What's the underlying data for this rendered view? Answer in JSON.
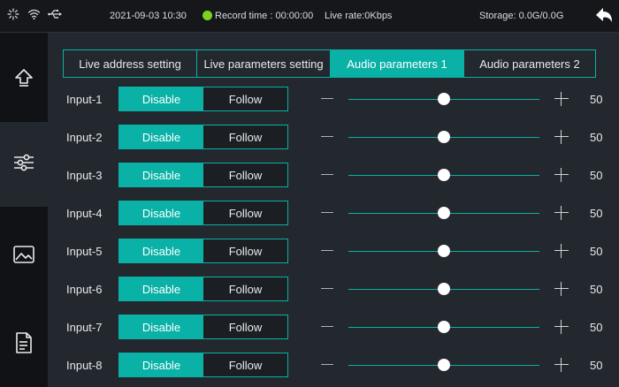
{
  "status_bar": {
    "datetime": "2021-09-03 10:30",
    "record_time": "Record time : 00:00:00",
    "live_rate": "Live rate:0Kbps",
    "storage": "Storage: 0.0G/0.0G",
    "record_indicator_color": "#7ed321"
  },
  "sidebar": {
    "items": [
      {
        "name": "upload",
        "icon": "upload-icon",
        "active": false
      },
      {
        "name": "settings",
        "icon": "sliders-icon",
        "active": true
      },
      {
        "name": "gallery",
        "icon": "image-icon",
        "active": false
      },
      {
        "name": "document",
        "icon": "document-icon",
        "active": false
      }
    ]
  },
  "tabs": [
    {
      "label": "Live address setting",
      "active": false
    },
    {
      "label": "Live parameters setting",
      "active": false
    },
    {
      "label": "Audio parameters 1",
      "active": true
    },
    {
      "label": "Audio parameters 2",
      "active": false
    }
  ],
  "inputs": [
    {
      "label": "Input-1",
      "disable_label": "Disable",
      "follow_label": "Follow",
      "selected": "Disable",
      "volume": 50,
      "level": 0.5
    },
    {
      "label": "Input-2",
      "disable_label": "Disable",
      "follow_label": "Follow",
      "selected": "Disable",
      "volume": 50,
      "level": 0.5
    },
    {
      "label": "Input-3",
      "disable_label": "Disable",
      "follow_label": "Follow",
      "selected": "Disable",
      "volume": 50,
      "level": 0.5
    },
    {
      "label": "Input-4",
      "disable_label": "Disable",
      "follow_label": "Follow",
      "selected": "Disable",
      "volume": 50,
      "level": 0.5
    },
    {
      "label": "Input-5",
      "disable_label": "Disable",
      "follow_label": "Follow",
      "selected": "Disable",
      "volume": 50,
      "level": 0.5
    },
    {
      "label": "Input-6",
      "disable_label": "Disable",
      "follow_label": "Follow",
      "selected": "Disable",
      "volume": 50,
      "level": 0.5
    },
    {
      "label": "Input-7",
      "disable_label": "Disable",
      "follow_label": "Follow",
      "selected": "Disable",
      "volume": 50,
      "level": 0.5
    },
    {
      "label": "Input-8",
      "disable_label": "Disable",
      "follow_label": "Follow",
      "selected": "Disable",
      "volume": 50,
      "level": 0.5
    }
  ],
  "colors": {
    "accent": "#0ab1a6",
    "background": "#23272e",
    "sidebar": "#101215"
  }
}
